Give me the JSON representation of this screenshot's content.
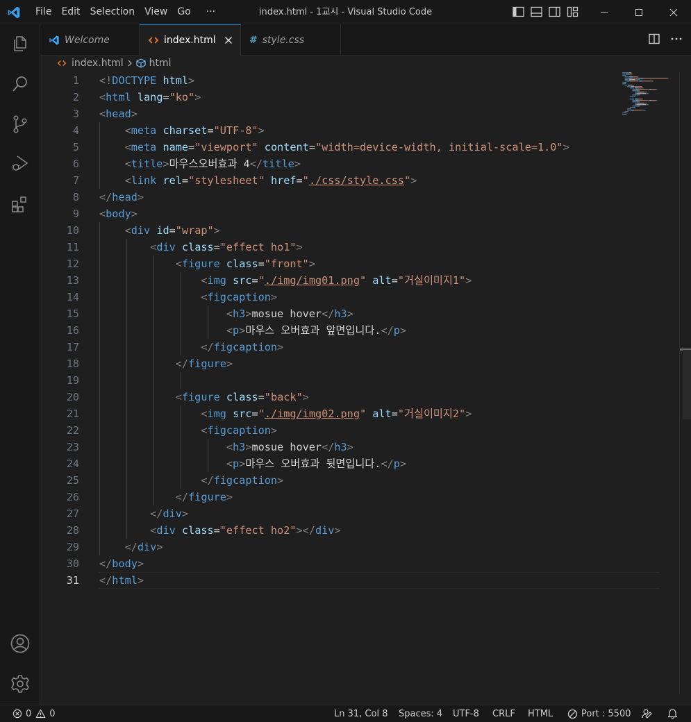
{
  "titlebar": {
    "menus": [
      "File",
      "Edit",
      "Selection",
      "View",
      "Go",
      "···"
    ],
    "title": "index.html - 1교시 - Visual Studio Code"
  },
  "tabs": [
    {
      "label": "Welcome",
      "icon": "vscode-logo-icon"
    },
    {
      "label": "index.html",
      "icon": "html-file-icon",
      "active": true
    },
    {
      "label": "style.css",
      "icon": "css-file-icon"
    }
  ],
  "breadcrumb": {
    "file": "index.html",
    "symbol": "html"
  },
  "editor": {
    "current_line": 31,
    "lines": [
      [
        [
          "b",
          "<!"
        ],
        [
          "t",
          "DOCTYPE"
        ],
        [
          "x",
          " "
        ],
        [
          "a",
          "html"
        ],
        [
          "b",
          ">"
        ]
      ],
      [
        [
          "b",
          "<"
        ],
        [
          "t",
          "html"
        ],
        [
          "x",
          " "
        ],
        [
          "a",
          "lang"
        ],
        [
          "x",
          "="
        ],
        [
          "s",
          "\"ko\""
        ],
        [
          "b",
          ">"
        ]
      ],
      [
        [
          "b",
          "<"
        ],
        [
          "t",
          "head"
        ],
        [
          "b",
          ">"
        ]
      ],
      [
        [
          "x",
          "    "
        ],
        [
          "b",
          "<"
        ],
        [
          "t",
          "meta"
        ],
        [
          "x",
          " "
        ],
        [
          "a",
          "charset"
        ],
        [
          "x",
          "="
        ],
        [
          "s",
          "\"UTF-8\""
        ],
        [
          "b",
          ">"
        ]
      ],
      [
        [
          "x",
          "    "
        ],
        [
          "b",
          "<"
        ],
        [
          "t",
          "meta"
        ],
        [
          "x",
          " "
        ],
        [
          "a",
          "name"
        ],
        [
          "x",
          "="
        ],
        [
          "s",
          "\"viewport\""
        ],
        [
          "x",
          " "
        ],
        [
          "a",
          "content"
        ],
        [
          "x",
          "="
        ],
        [
          "s",
          "\"width=device-width, initial-scale=1.0\""
        ],
        [
          "b",
          ">"
        ]
      ],
      [
        [
          "x",
          "    "
        ],
        [
          "b",
          "<"
        ],
        [
          "t",
          "title"
        ],
        [
          "b",
          ">"
        ],
        [
          "x",
          "마우스오버효과 4"
        ],
        [
          "b",
          "</"
        ],
        [
          "t",
          "title"
        ],
        [
          "b",
          ">"
        ]
      ],
      [
        [
          "x",
          "    "
        ],
        [
          "b",
          "<"
        ],
        [
          "t",
          "link"
        ],
        [
          "x",
          " "
        ],
        [
          "a",
          "rel"
        ],
        [
          "x",
          "="
        ],
        [
          "s",
          "\"stylesheet\""
        ],
        [
          "x",
          " "
        ],
        [
          "a",
          "href"
        ],
        [
          "x",
          "="
        ],
        [
          "s",
          "\""
        ],
        [
          "su",
          "./css/style.css"
        ],
        [
          "s",
          "\""
        ],
        [
          "b",
          ">"
        ]
      ],
      [
        [
          "b",
          "</"
        ],
        [
          "t",
          "head"
        ],
        [
          "b",
          ">"
        ]
      ],
      [
        [
          "b",
          "<"
        ],
        [
          "t",
          "body"
        ],
        [
          "b",
          ">"
        ]
      ],
      [
        [
          "x",
          "    "
        ],
        [
          "b",
          "<"
        ],
        [
          "t",
          "div"
        ],
        [
          "x",
          " "
        ],
        [
          "a",
          "id"
        ],
        [
          "x",
          "="
        ],
        [
          "s",
          "\"wrap\""
        ],
        [
          "b",
          ">"
        ]
      ],
      [
        [
          "x",
          "        "
        ],
        [
          "b",
          "<"
        ],
        [
          "t",
          "div"
        ],
        [
          "x",
          " "
        ],
        [
          "a",
          "class"
        ],
        [
          "x",
          "="
        ],
        [
          "s",
          "\"effect ho1\""
        ],
        [
          "b",
          ">"
        ]
      ],
      [
        [
          "x",
          "            "
        ],
        [
          "b",
          "<"
        ],
        [
          "t",
          "figure"
        ],
        [
          "x",
          " "
        ],
        [
          "a",
          "class"
        ],
        [
          "x",
          "="
        ],
        [
          "s",
          "\"front\""
        ],
        [
          "b",
          ">"
        ]
      ],
      [
        [
          "x",
          "                "
        ],
        [
          "b",
          "<"
        ],
        [
          "t",
          "img"
        ],
        [
          "x",
          " "
        ],
        [
          "a",
          "src"
        ],
        [
          "x",
          "="
        ],
        [
          "s",
          "\""
        ],
        [
          "su",
          "./img/img01.png"
        ],
        [
          "s",
          "\""
        ],
        [
          "x",
          " "
        ],
        [
          "a",
          "alt"
        ],
        [
          "x",
          "="
        ],
        [
          "s",
          "\"거실이미지1\""
        ],
        [
          "b",
          ">"
        ]
      ],
      [
        [
          "x",
          "                "
        ],
        [
          "b",
          "<"
        ],
        [
          "t",
          "figcaption"
        ],
        [
          "b",
          ">"
        ]
      ],
      [
        [
          "x",
          "                    "
        ],
        [
          "b",
          "<"
        ],
        [
          "t",
          "h3"
        ],
        [
          "b",
          ">"
        ],
        [
          "x",
          "mosue hover"
        ],
        [
          "b",
          "</"
        ],
        [
          "t",
          "h3"
        ],
        [
          "b",
          ">"
        ]
      ],
      [
        [
          "x",
          "                    "
        ],
        [
          "b",
          "<"
        ],
        [
          "t",
          "p"
        ],
        [
          "b",
          ">"
        ],
        [
          "x",
          "마우스 오버효과 앞면입니다."
        ],
        [
          "b",
          "</"
        ],
        [
          "t",
          "p"
        ],
        [
          "b",
          ">"
        ]
      ],
      [
        [
          "x",
          "                "
        ],
        [
          "b",
          "</"
        ],
        [
          "t",
          "figcaption"
        ],
        [
          "b",
          ">"
        ]
      ],
      [
        [
          "x",
          "            "
        ],
        [
          "b",
          "</"
        ],
        [
          "t",
          "figure"
        ],
        [
          "b",
          ">"
        ]
      ],
      [],
      [
        [
          "x",
          "            "
        ],
        [
          "b",
          "<"
        ],
        [
          "t",
          "figure"
        ],
        [
          "x",
          " "
        ],
        [
          "a",
          "class"
        ],
        [
          "x",
          "="
        ],
        [
          "s",
          "\"back\""
        ],
        [
          "b",
          ">"
        ]
      ],
      [
        [
          "x",
          "                "
        ],
        [
          "b",
          "<"
        ],
        [
          "t",
          "img"
        ],
        [
          "x",
          " "
        ],
        [
          "a",
          "src"
        ],
        [
          "x",
          "="
        ],
        [
          "s",
          "\""
        ],
        [
          "su",
          "./img/img02.png"
        ],
        [
          "s",
          "\""
        ],
        [
          "x",
          " "
        ],
        [
          "a",
          "alt"
        ],
        [
          "x",
          "="
        ],
        [
          "s",
          "\"거실이미지2\""
        ],
        [
          "b",
          ">"
        ]
      ],
      [
        [
          "x",
          "                "
        ],
        [
          "b",
          "<"
        ],
        [
          "t",
          "figcaption"
        ],
        [
          "b",
          ">"
        ]
      ],
      [
        [
          "x",
          "                    "
        ],
        [
          "b",
          "<"
        ],
        [
          "t",
          "h3"
        ],
        [
          "b",
          ">"
        ],
        [
          "x",
          "mosue hover"
        ],
        [
          "b",
          "</"
        ],
        [
          "t",
          "h3"
        ],
        [
          "b",
          ">"
        ]
      ],
      [
        [
          "x",
          "                    "
        ],
        [
          "b",
          "<"
        ],
        [
          "t",
          "p"
        ],
        [
          "b",
          ">"
        ],
        [
          "x",
          "마우스 오버효과 뒷면입니다."
        ],
        [
          "b",
          "</"
        ],
        [
          "t",
          "p"
        ],
        [
          "b",
          ">"
        ]
      ],
      [
        [
          "x",
          "                "
        ],
        [
          "b",
          "</"
        ],
        [
          "t",
          "figcaption"
        ],
        [
          "b",
          ">"
        ]
      ],
      [
        [
          "x",
          "            "
        ],
        [
          "b",
          "</"
        ],
        [
          "t",
          "figure"
        ],
        [
          "b",
          ">"
        ]
      ],
      [
        [
          "x",
          "        "
        ],
        [
          "b",
          "</"
        ],
        [
          "t",
          "div"
        ],
        [
          "b",
          ">"
        ]
      ],
      [
        [
          "x",
          "        "
        ],
        [
          "b",
          "<"
        ],
        [
          "t",
          "div"
        ],
        [
          "x",
          " "
        ],
        [
          "a",
          "class"
        ],
        [
          "x",
          "="
        ],
        [
          "s",
          "\"effect ho2\""
        ],
        [
          "b",
          "></"
        ],
        [
          "t",
          "div"
        ],
        [
          "b",
          ">"
        ]
      ],
      [
        [
          "x",
          "    "
        ],
        [
          "b",
          "</"
        ],
        [
          "t",
          "div"
        ],
        [
          "b",
          ">"
        ]
      ],
      [
        [
          "b",
          "</"
        ],
        [
          "t",
          "body"
        ],
        [
          "b",
          ">"
        ]
      ],
      [
        [
          "b",
          "</"
        ],
        [
          "t",
          "html"
        ],
        [
          "b",
          ">"
        ]
      ]
    ]
  },
  "statusbar": {
    "errors": "0",
    "warnings": "0",
    "position": "Ln 31, Col 8",
    "spaces": "Spaces: 4",
    "encoding": "UTF-8",
    "eol": "CRLF",
    "language": "HTML",
    "port": "Port : 5500"
  },
  "colors": {
    "accent": "#0078d4",
    "tag": "#569cd6",
    "attribute": "#9cdcfe",
    "string": "#ce9178",
    "bracket": "#808080",
    "text": "#d4d4d4",
    "vscode_blue": "#3ba0ef",
    "html_icon": "#e37933",
    "css_icon": "#519aba"
  }
}
